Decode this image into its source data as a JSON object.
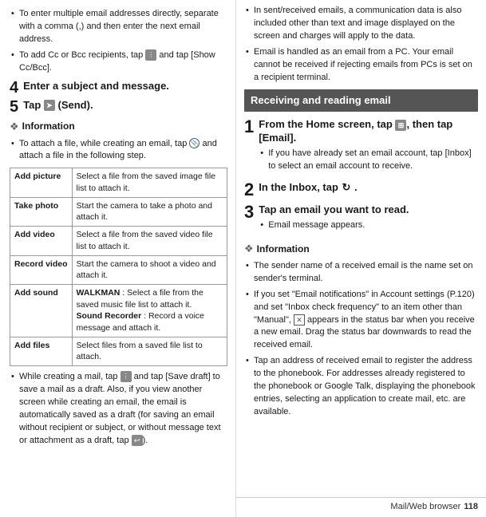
{
  "left": {
    "bullets_top": [
      "To enter multiple email addresses directly, separate with a comma (,) and then enter the next email address.",
      "To add Cc or Bcc recipients, tap  and tap [Show Cc/Bcc]."
    ],
    "step4": {
      "number": "4",
      "title": "Enter a subject and message."
    },
    "step5": {
      "number": "5",
      "title": "Tap  (Send)."
    },
    "info_label": "Information",
    "info_bullet": "To attach a file, while creating an email, tap  and attach a file in the following step.",
    "table": [
      {
        "action": "Add picture",
        "description": "Select a file from the saved image file list to attach it."
      },
      {
        "action": "Take photo",
        "description": "Start the camera to take a photo and attach it."
      },
      {
        "action": "Add video",
        "description": "Select a file from the saved video file list to attach it."
      },
      {
        "action": "Record video",
        "description": "Start the camera to shoot a video and attach it."
      },
      {
        "action": "Add sound",
        "description": "WALKMAN : Select a file from the saved music file list to attach it. Sound Recorder : Record a voice message and attach it."
      },
      {
        "action": "Add files",
        "description": "Select files from a saved file list to attach."
      }
    ],
    "bottom_bullet": "While creating a mail, tap  and tap [Save draft] to save a mail as a draft. Also, if you view another screen while creating an email, the email is automatically saved as a draft (for saving an email without recipient or subject, or without message text or attachment as a draft, tap )."
  },
  "right": {
    "top_bullets": [
      "In sent/received emails, a communication data is also included other than text and image displayed on the screen and charges will apply to the data.",
      "Email is handled as an email from a PC. Your email cannot be received if rejecting emails from PCs is set on a recipient terminal."
    ],
    "banner_title": "Receiving and reading email",
    "step1": {
      "number": "1",
      "title": "From the Home screen, tap  , then tap [Email].",
      "bullet": "If you have already set an email account, tap [Inbox] to select an email account to receive."
    },
    "step2": {
      "number": "2",
      "title": "In the Inbox, tap  ."
    },
    "step3": {
      "number": "3",
      "title": "Tap an email you want to read.",
      "bullet": "Email message appears."
    },
    "info_label": "Information",
    "info_bullets": [
      "The sender name of a received email is the name set on sender's terminal.",
      "If you set \"Email notifications\" in Account settings (P.120) and set \"Inbox check frequency\" to an item other than \"Manual\",  appears in the status bar when you receive a new email. Drag the status bar downwards to read the received email.",
      "Tap an address of received email to register the address to the phonebook. For addresses already registered to the phonebook or Google Talk, displaying the phonebook entries, selecting an application to create mail, etc. are available."
    ]
  },
  "footer": {
    "label": "Mail/Web browser",
    "page": "118"
  }
}
